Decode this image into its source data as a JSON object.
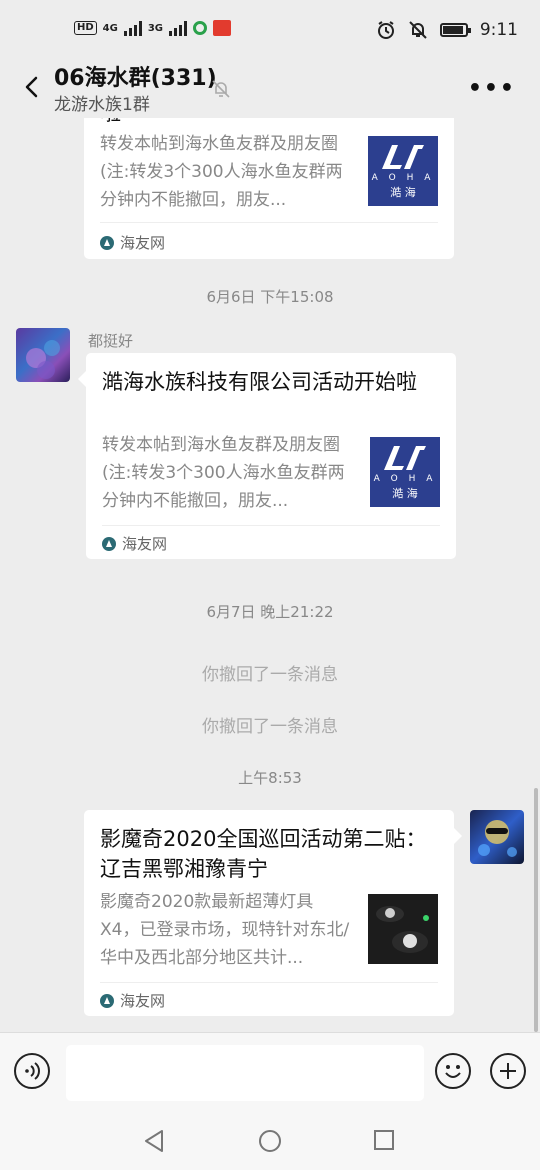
{
  "status_bar": {
    "network_hd": "HD",
    "network_4g": "4G",
    "network_3g": "3G",
    "time": "9:11",
    "battery_level": 0.85
  },
  "header": {
    "title": "06海水群(331)",
    "subtitle": "龙游水族1群",
    "back_icon": "back-chevron-icon",
    "mute_icon": "bell-off-icon",
    "more_icon": "more-dots-icon"
  },
  "messages": [
    {
      "type": "link_card",
      "side": "left",
      "title_partial": "啦",
      "desc": "转发本帖到海水鱼友群及朋友圈(注:转发3个300人海水鱼友群两分钟内不能撤回，朋友...",
      "source": "海友网",
      "thumb": {
        "letters": "A O H A",
        "cn": "澔 海"
      }
    },
    {
      "type": "timestamp",
      "text": "6月6日 下午15:08"
    },
    {
      "type": "link_card",
      "side": "left",
      "sender": "都挺好",
      "title": "澔海水族科技有限公司活动开始啦",
      "desc": "转发本帖到海水鱼友群及朋友圈(注:转发3个300人海水鱼友群两分钟内不能撤回，朋友...",
      "source": "海友网",
      "thumb": {
        "letters": "A O H A",
        "cn": "澔 海"
      }
    },
    {
      "type": "timestamp",
      "text": "6月7日 晚上21:22"
    },
    {
      "type": "recall",
      "text": "你撤回了一条消息"
    },
    {
      "type": "recall",
      "text": "你撤回了一条消息"
    },
    {
      "type": "timestamp",
      "text": "上午8:53"
    },
    {
      "type": "link_card",
      "side": "right",
      "title": "影魔奇2020全国巡回活动第二贴：  辽吉黑鄂湘豫青宁",
      "desc": "影魔奇2020款最新超薄灯具X4，已登录市场，现特针对东北/华中及西北部分地区共计...",
      "source": "海友网"
    }
  ],
  "input_bar": {
    "voice_icon": "voice-icon",
    "emoji_icon": "emoji-icon",
    "plus_icon": "plus-icon",
    "placeholder": ""
  },
  "nav_bar": {
    "back_icon": "nav-back-icon",
    "home_icon": "nav-home-icon",
    "recents_icon": "nav-recents-icon"
  },
  "colors": {
    "background": "#ededed",
    "bubble": "#ffffff",
    "thumb_blue": "#2c3f8f"
  }
}
